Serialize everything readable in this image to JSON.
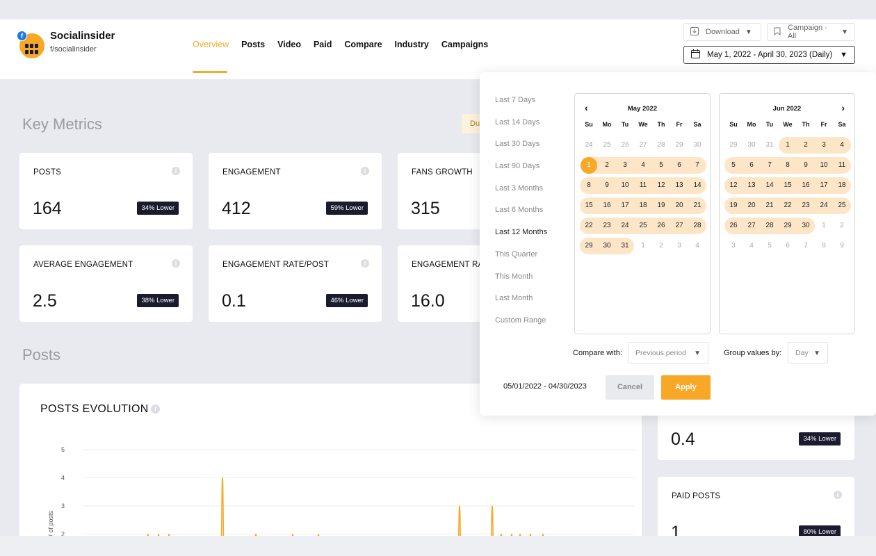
{
  "brand": {
    "name": "Socialinsider",
    "handle": "f/socialinsider",
    "network_badge": "f"
  },
  "nav": {
    "items": [
      "Overview",
      "Posts",
      "Video",
      "Paid",
      "Compare",
      "Industry",
      "Campaigns"
    ],
    "active": "Overview"
  },
  "toolbar": {
    "download_label": "Download",
    "campaign_label": "Campaign · All",
    "date_range_label": "May 1, 2022 - April 30, 2023 (Daily)"
  },
  "key_metrics": {
    "title": "Key Metrics",
    "notice_partial": "Du",
    "cards": [
      {
        "label": "POSTS",
        "value": "164",
        "badge": "34% Lower"
      },
      {
        "label": "ENGAGEMENT",
        "value": "412",
        "badge": "59% Lower"
      },
      {
        "label": "FANS GROWTH",
        "value": "315",
        "badge": ""
      },
      {
        "label": "AVERAGE ENGAGEMENT",
        "value": "2.5",
        "badge": "38% Lower"
      },
      {
        "label": "ENGAGEMENT RATE/POST",
        "value": "0.1",
        "badge": "46% Lower"
      },
      {
        "label": "ENGAGEMENT RA",
        "value": "16.0",
        "badge": ""
      }
    ]
  },
  "posts_section": {
    "title": "Posts",
    "side_cards": [
      {
        "label": "",
        "value": "0.4",
        "badge": "34% Lower"
      },
      {
        "label": "PAID POSTS",
        "value": "1",
        "badge": "80% Lower"
      }
    ]
  },
  "chart": {
    "title": "POSTS EVOLUTION",
    "ylabel": "# of posts",
    "y_ticks": [
      "5",
      "4",
      "3",
      "2"
    ]
  },
  "chart_data": {
    "type": "line",
    "title": "POSTS EVOLUTION",
    "ylabel": "# of posts",
    "xlabel": "",
    "ylim": [
      2,
      5
    ],
    "y_ticks": [
      5,
      4,
      3,
      2
    ],
    "grid": true,
    "series": [
      {
        "values": [
          2,
          2,
          2,
          4,
          2,
          2,
          2,
          3,
          3,
          2,
          2,
          2,
          2,
          2
        ]
      }
    ]
  },
  "date_picker": {
    "ranges": [
      "Last 7 Days",
      "Last 14 Days",
      "Last 30 Days",
      "Last 90 Days",
      "Last 3 Months",
      "Last 6 Months",
      "Last 12 Months",
      "This Quarter",
      "This Month",
      "Last Month",
      "Custom Range"
    ],
    "selected_range": "Last 12 Months",
    "weekdays": [
      "Su",
      "Mo",
      "Tu",
      "We",
      "Th",
      "Fr",
      "Sa"
    ],
    "calendars": [
      {
        "month": "May 2022",
        "weeks": [
          [
            "24",
            "25",
            "26",
            "27",
            "28",
            "29",
            "30"
          ],
          [
            "1",
            "2",
            "3",
            "4",
            "5",
            "6",
            "7"
          ],
          [
            "8",
            "9",
            "10",
            "11",
            "12",
            "13",
            "14"
          ],
          [
            "15",
            "16",
            "17",
            "18",
            "19",
            "20",
            "21"
          ],
          [
            "22",
            "23",
            "24",
            "25",
            "26",
            "27",
            "28"
          ],
          [
            "29",
            "30",
            "31",
            "1",
            "2",
            "3",
            "4"
          ]
        ]
      },
      {
        "month": "Jun 2022",
        "weeks": [
          [
            "29",
            "30",
            "31",
            "1",
            "2",
            "3",
            "4"
          ],
          [
            "5",
            "6",
            "7",
            "8",
            "9",
            "10",
            "11"
          ],
          [
            "12",
            "13",
            "14",
            "15",
            "16",
            "17",
            "18"
          ],
          [
            "19",
            "20",
            "21",
            "22",
            "23",
            "24",
            "25"
          ],
          [
            "26",
            "27",
            "28",
            "29",
            "30",
            "1",
            "2"
          ],
          [
            "3",
            "4",
            "5",
            "6",
            "7",
            "8",
            "9"
          ]
        ]
      }
    ],
    "compare_label": "Compare with:",
    "compare_value": "Previous period",
    "group_label": "Group values by:",
    "group_value": "Day",
    "range_text": "05/01/2022 - 04/30/2023",
    "cancel_label": "Cancel",
    "apply_label": "Apply"
  },
  "colors": {
    "accent": "#f7a827",
    "badge_bg": "#1b1b2f",
    "range_highlight": "#fde6c8"
  }
}
